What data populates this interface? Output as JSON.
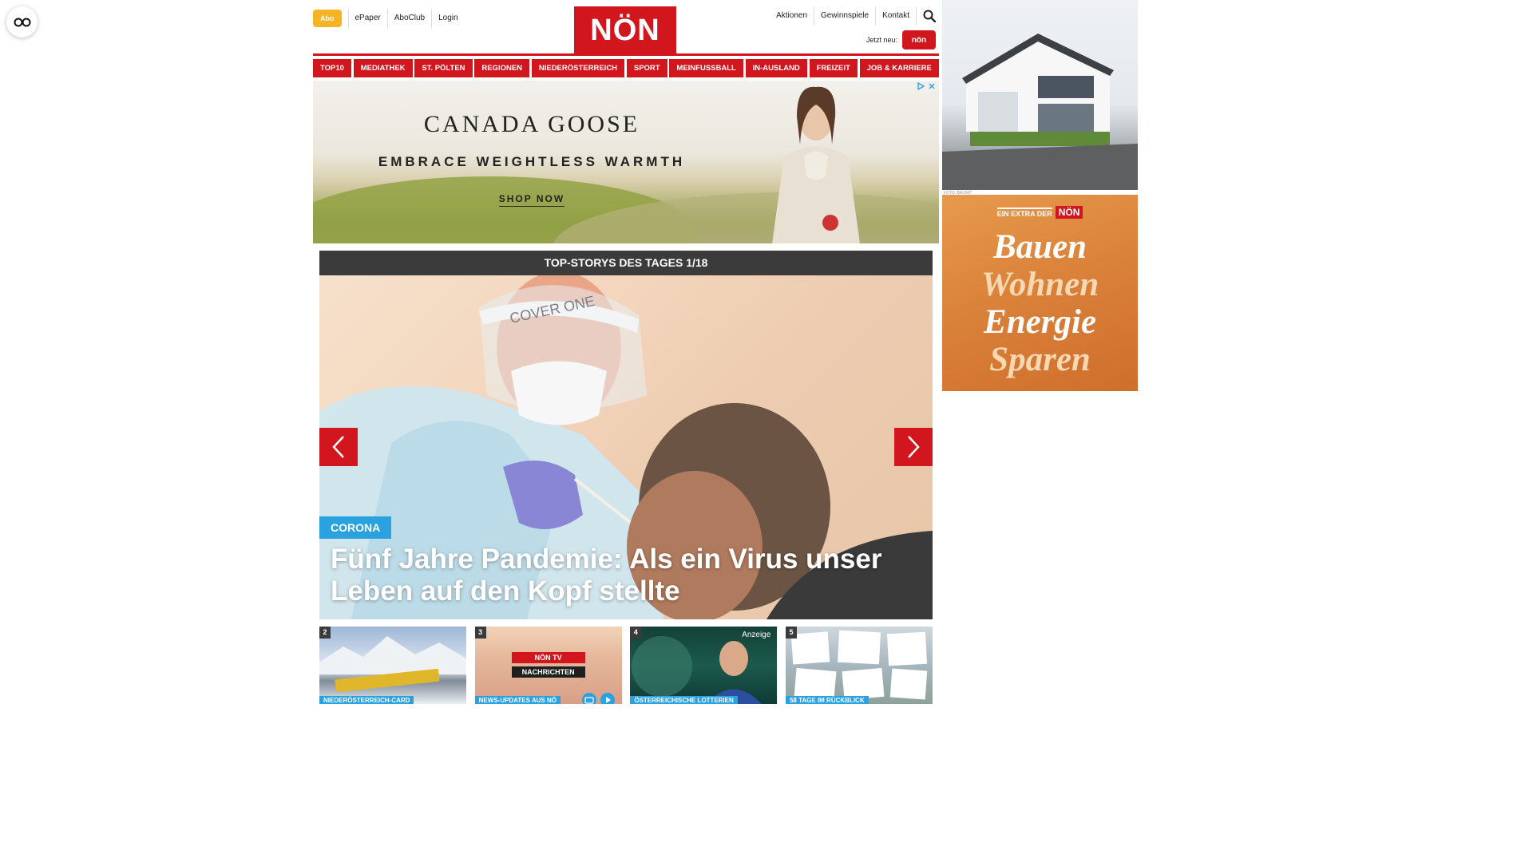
{
  "accessibility": {
    "icon": "glasses-icon"
  },
  "header": {
    "abo_label": "Abo",
    "util_left": [
      "ePaper",
      "AboClub",
      "Login"
    ],
    "logo_text": "NÖN",
    "util_right": [
      "Aktionen",
      "Gewinnspiele",
      "Kontakt"
    ],
    "jetzt_label": "Jetzt neu:",
    "jetzt_logo_text": "nön"
  },
  "nav": {
    "items": [
      "TOP10",
      "MEDIATHEK",
      "ST. PÖLTEN",
      "REGIONEN",
      "NIEDERÖSTERREICH",
      "SPORT",
      "MEINFUSSBALL",
      "IN-AUSLAND",
      "FREIZEIT",
      "JOB & KARRIERE"
    ]
  },
  "ad_banner": {
    "brand": "CANADA GOOSE",
    "tagline": "EMBRACE WEIGHTLESS WARMTH",
    "cta": "SHOP NOW"
  },
  "carousel": {
    "heading": "TOP-STORYS DES TAGES 1/18",
    "hero_category": "CORONA",
    "hero_title": "Fünf Jahre Pandemie: Als ein Virus unser Leben auf den Kopf stellte",
    "thumbs": [
      {
        "num": "2",
        "category": "NIEDERÖSTERREICH-CARD",
        "badge": ""
      },
      {
        "num": "3",
        "category": "NEWS-UPDATES AUS NÖ",
        "badge": ""
      },
      {
        "num": "4",
        "category": "ÖSTERREICHISCHE LOTTERIEN",
        "badge": "Anzeige"
      },
      {
        "num": "5",
        "category": "58 TAGE IM RÜCKBLICK",
        "badge": ""
      }
    ],
    "thumb3_banner": "NACHRICHTEN",
    "thumb3_logo": "NÖN TV"
  },
  "side_ad": {
    "extra_label": "EIN EXTRA DER",
    "extra_logo": "NÖN",
    "words": [
      "Bauen",
      "Wohnen",
      "Energie",
      "Sparen"
    ],
    "credit": "FOTO: BAUMIT"
  },
  "colors": {
    "brand_red": "#d2161e",
    "abo_yellow": "#f6b324",
    "tag_blue": "#2aa2e0",
    "dark_bar": "#3b3b3b"
  }
}
